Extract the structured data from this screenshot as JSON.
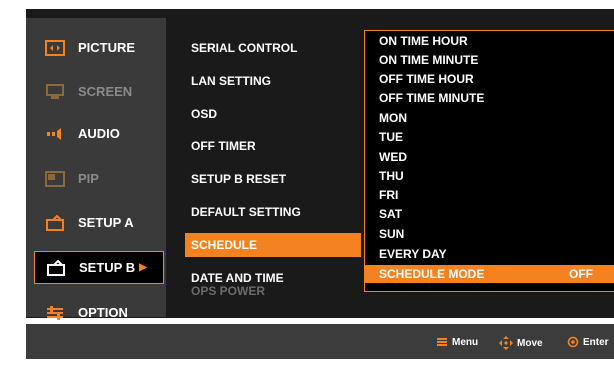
{
  "main_menu": {
    "items": [
      {
        "label": "PICTURE",
        "icon": "picture-icon",
        "state": "enabled"
      },
      {
        "label": "SCREEN",
        "icon": "screen-icon",
        "state": "disabled"
      },
      {
        "label": "AUDIO",
        "icon": "audio-icon",
        "state": "enabled"
      },
      {
        "label": "PIP",
        "icon": "pip-icon",
        "state": "disabled"
      },
      {
        "label": "SETUP A",
        "icon": "setup-a-icon",
        "state": "enabled"
      },
      {
        "label": "SETUP B",
        "icon": "setup-b-icon",
        "state": "selected"
      },
      {
        "label": "OPTION",
        "icon": "option-icon",
        "state": "enabled"
      }
    ]
  },
  "setup_b_menu": {
    "items": [
      {
        "label": "SERIAL CONTROL",
        "state": "enabled"
      },
      {
        "label": "LAN SETTING",
        "state": "enabled"
      },
      {
        "label": "OSD",
        "state": "enabled"
      },
      {
        "label": "OFF TIMER",
        "state": "enabled"
      },
      {
        "label": "SETUP B RESET",
        "state": "enabled"
      },
      {
        "label": "DEFAULT SETTING",
        "state": "enabled"
      },
      {
        "label": "SCHEDULE",
        "state": "selected"
      },
      {
        "label": "DATE AND TIME",
        "state": "enabled"
      },
      {
        "label": "OPS POWER",
        "state": "disabled"
      }
    ]
  },
  "schedule_menu": {
    "items": [
      {
        "label": "ON TIME HOUR",
        "value": ""
      },
      {
        "label": "ON TIME MINUTE",
        "value": ""
      },
      {
        "label": "OFF TIME HOUR",
        "value": ""
      },
      {
        "label": "OFF TIME MINUTE",
        "value": ""
      },
      {
        "label": "MON",
        "value": ""
      },
      {
        "label": "TUE",
        "value": ""
      },
      {
        "label": "WED",
        "value": ""
      },
      {
        "label": "THU",
        "value": ""
      },
      {
        "label": "FRI",
        "value": ""
      },
      {
        "label": "SAT",
        "value": ""
      },
      {
        "label": "SUN",
        "value": ""
      },
      {
        "label": "EVERY DAY",
        "value": ""
      },
      {
        "label": "SCHEDULE MODE",
        "value": "OFF"
      }
    ]
  },
  "footer": {
    "menu_label": "Menu",
    "move_label": "Move",
    "enter_label": "Enter"
  },
  "colors": {
    "accent": "#f58220",
    "background": "#1a1a1a",
    "panel": "#3a3a3a"
  }
}
